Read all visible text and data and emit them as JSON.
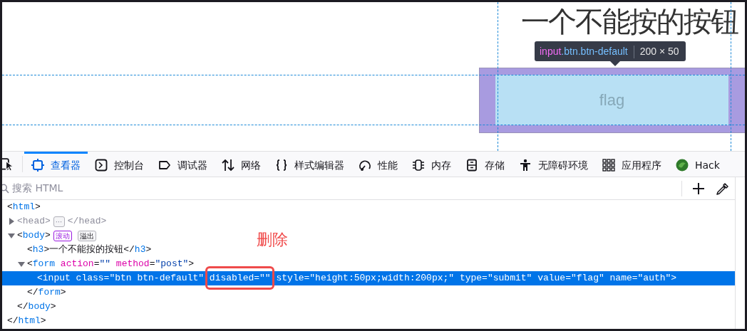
{
  "viewport": {
    "heading": "一个不能按的按钮",
    "button": {
      "value": "flag",
      "disabled": true
    },
    "tooltip": {
      "tag": "input",
      "classes": ".btn.btn-default",
      "size": "200 × 50"
    }
  },
  "toolbar": {
    "tabs": [
      {
        "label": "查看器",
        "kind": "inspector",
        "selected": true
      },
      {
        "label": "控制台",
        "kind": "console",
        "selected": false
      },
      {
        "label": "调试器",
        "kind": "debugger",
        "selected": false
      },
      {
        "label": "网络",
        "kind": "network",
        "selected": false
      },
      {
        "label": "样式编辑器",
        "kind": "style",
        "selected": false
      },
      {
        "label": "性能",
        "kind": "performance",
        "selected": false
      },
      {
        "label": "内存",
        "kind": "memory",
        "selected": false
      },
      {
        "label": "存储",
        "kind": "storage",
        "selected": false
      },
      {
        "label": "无障碍环境",
        "kind": "accessibility",
        "selected": false
      },
      {
        "label": "应用程序",
        "kind": "application",
        "selected": false
      },
      {
        "label": "Hack",
        "kind": "addon",
        "selected": false
      }
    ]
  },
  "search": {
    "placeholder": "搜索 HTML"
  },
  "tree": [
    {
      "tokens": [
        {
          "kind": "punct",
          "text": "<"
        },
        {
          "kind": "tag",
          "text": "html"
        },
        {
          "kind": "punct",
          "text": ">"
        }
      ],
      "selected": false,
      "close_tokens": [
        {
          "kind": "punct",
          "text": "</"
        },
        {
          "kind": "tag",
          "text": "html"
        },
        {
          "kind": "punct",
          "text": ">"
        }
      ],
      "children": [
        {
          "tokens": [
            {
              "text": "<head>"
            }
          ],
          "badges": [
            {
              "text": "⋯",
              "kind": "collapsed"
            }
          ],
          "tail_tokens": [
            {
              "text": "</head>"
            }
          ],
          "expanded": false,
          "dimmed": true,
          "selected": false
        },
        {
          "tokens": [
            {
              "kind": "punct",
              "text": "<"
            },
            {
              "kind": "tag",
              "text": "body"
            },
            {
              "kind": "punct",
              "text": ">"
            }
          ],
          "badges": [
            {
              "text": "滚动",
              "kind": "scroll"
            },
            {
              "text": "溢出",
              "kind": "overflow"
            }
          ],
          "expanded": true,
          "selected": false,
          "close_tokens": [
            {
              "kind": "punct",
              "text": "</"
            },
            {
              "kind": "tag",
              "text": "body"
            },
            {
              "kind": "punct",
              "text": ">"
            }
          ],
          "children": [
            {
              "tokens": [
                {
                  "kind": "punct",
                  "text": "<"
                },
                {
                  "kind": "tag",
                  "text": "h3"
                },
                {
                  "kind": "punct",
                  "text": ">"
                },
                {
                  "kind": "text",
                  "text": "一个不能按的按钮"
                },
                {
                  "kind": "punct",
                  "text": "</"
                },
                {
                  "kind": "tag",
                  "text": "h3"
                },
                {
                  "kind": "punct",
                  "text": ">"
                }
              ],
              "selected": false
            },
            {
              "tokens": [
                {
                  "kind": "punct",
                  "text": "<"
                },
                {
                  "kind": "tag",
                  "text": "form "
                },
                {
                  "kind": "attr",
                  "text": "action"
                },
                {
                  "kind": "punct",
                  "text": "="
                },
                {
                  "kind": "value",
                  "text": "\"\" "
                },
                {
                  "kind": "attr",
                  "text": "method"
                },
                {
                  "kind": "punct",
                  "text": "="
                },
                {
                  "kind": "value",
                  "text": "\"post\""
                },
                {
                  "kind": "punct",
                  "text": ">"
                }
              ],
              "expanded": true,
              "selected": false,
              "close_tokens": [
                {
                  "kind": "punct",
                  "text": "</"
                },
                {
                  "kind": "tag",
                  "text": "form"
                },
                {
                  "kind": "punct",
                  "text": ">"
                }
              ],
              "children": [
                {
                  "tokens": [
                    {
                      "text": "<input class=\"btn btn-default\" "
                    },
                    {
                      "text": "disabled=\"\"",
                      "annotated": true
                    },
                    {
                      "text": " style=\"height:50px;width:200px;\" type=\"submit\" value=\"flag\" name=\"auth\">"
                    }
                  ],
                  "selected": true
                }
              ]
            }
          ]
        }
      ]
    }
  ],
  "annotation": {
    "label": "删除"
  }
}
